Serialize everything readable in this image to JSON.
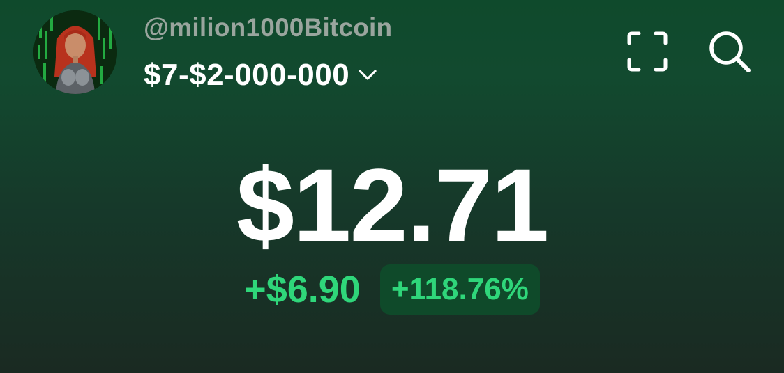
{
  "header": {
    "avatar_icon": "user-avatar-icon",
    "handle": "@milion1000Bitcoin",
    "wallet_name": "$7-$2-000-000",
    "wallet_dropdown_icon": "chevron-down-icon",
    "scan_icon": "scan-icon",
    "search_icon": "search-icon"
  },
  "portfolio": {
    "balance": "$12.71",
    "change_amount": "+$6.90",
    "change_percent": "+118.76%"
  },
  "colors": {
    "accent_green": "#2fd67a",
    "handle_gray": "#9aa59e",
    "badge_bg": "#0f4a2a"
  }
}
